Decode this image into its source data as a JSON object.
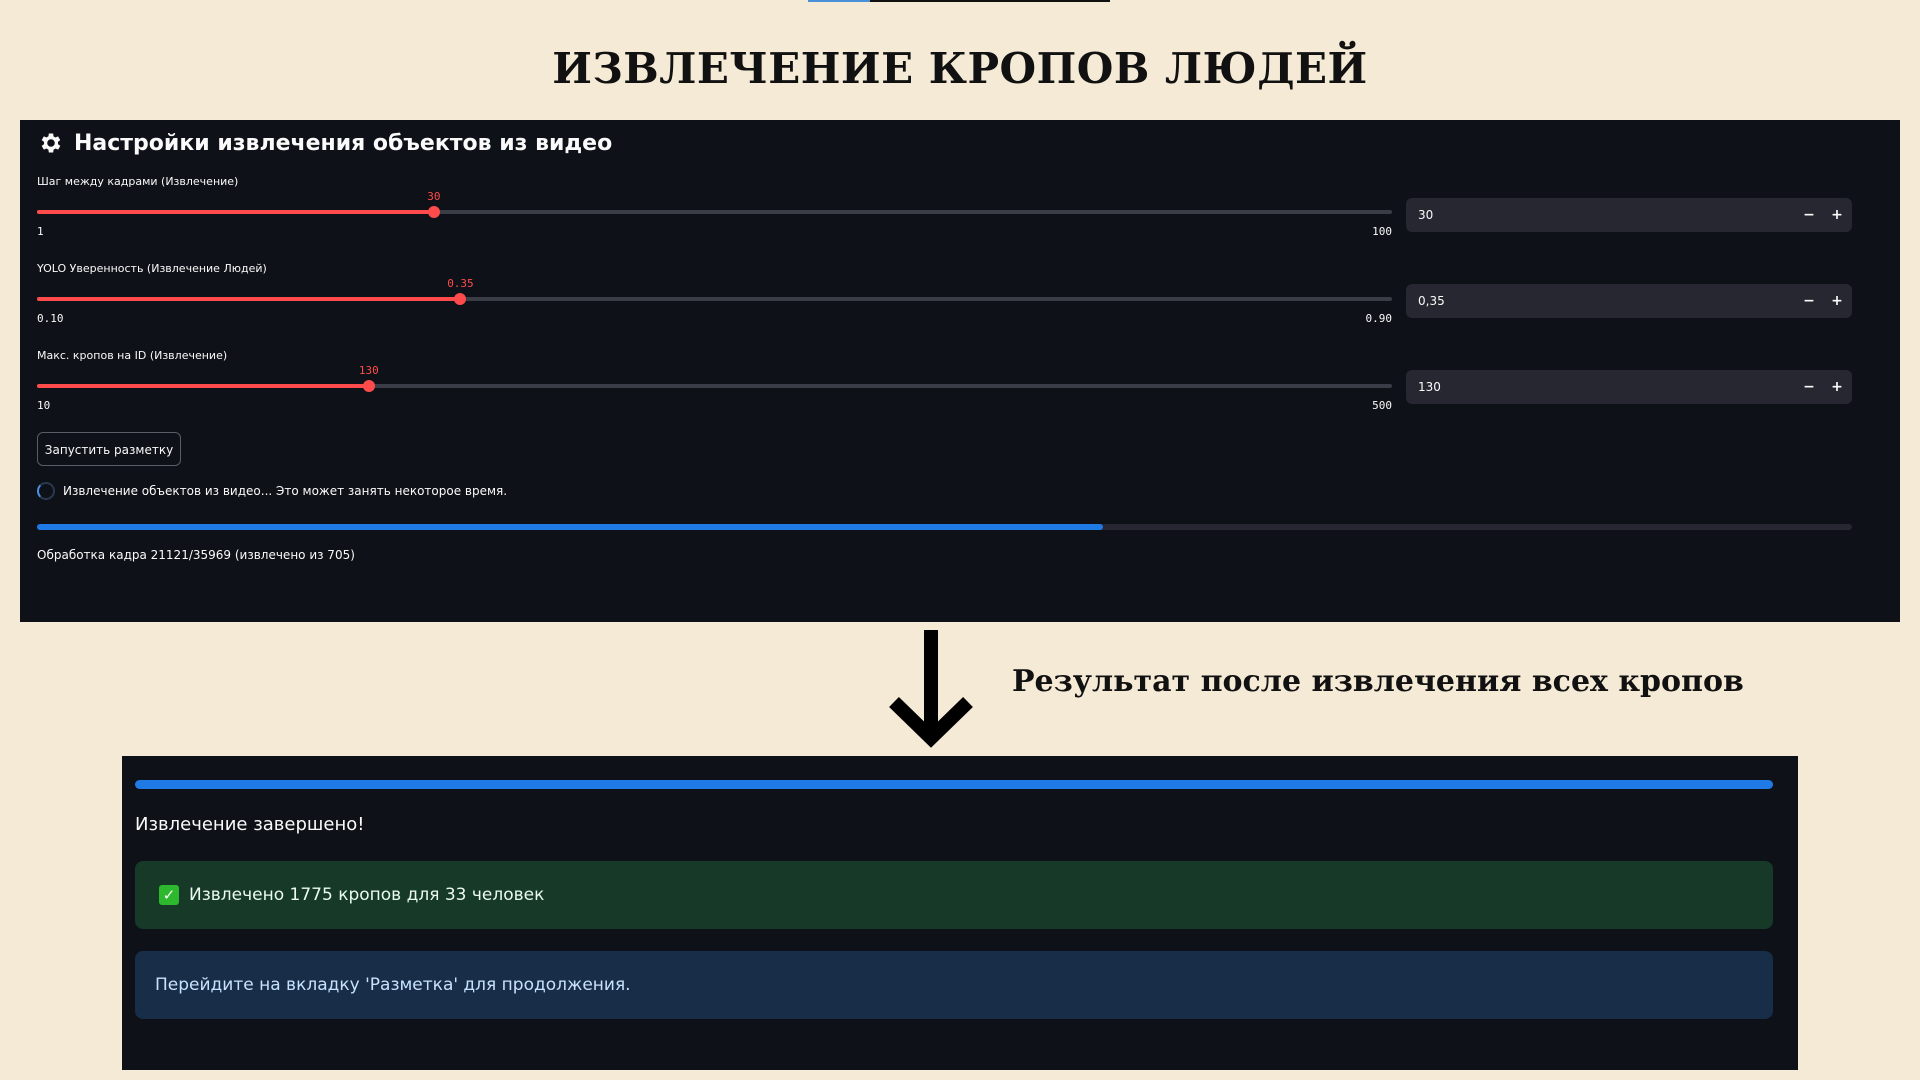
{
  "page": {
    "title": "ИЗВЛЕЧЕНИЕ КРОПОВ ЛЮДЕЙ",
    "result_caption": "Результат после извлечения всех кропов"
  },
  "settings": {
    "header": "Настройки извлечения объектов из видео",
    "header_icon": "gear-icon",
    "sliders": [
      {
        "label": "Шаг между кадрами (Извлечение)",
        "value": 30,
        "value_text": "30",
        "min": 1,
        "min_text": "1",
        "max": 100,
        "max_text": "100",
        "input_value": "30"
      },
      {
        "label": "YOLO Уверенность (Извлечение Людей)",
        "value": 0.35,
        "value_text": "0.35",
        "min": 0.1,
        "min_text": "0.10",
        "max": 0.9,
        "max_text": "0.90",
        "input_value": "0,35"
      },
      {
        "label": "Макс. кропов на ID (Извлечение)",
        "value": 130,
        "value_text": "130",
        "min": 10,
        "min_text": "10",
        "max": 500,
        "max_text": "500",
        "input_value": "130"
      }
    ],
    "stepper_minus": "−",
    "stepper_plus": "+",
    "run_button": "Запустить разметку",
    "spinner_text": "Извлечение объектов из видео... Это может занять некоторое время.",
    "progress": 0.5872,
    "progress_text": "Обработка кадра 21121/35969 (извлечено из 705)"
  },
  "result": {
    "progress": 1.0,
    "done_text": "Извлечение завершено!",
    "success_icon": "check-icon",
    "success_text": "Извлечено 1775 кропов для 33 человек",
    "info_text": "Перейдите на вкладку 'Разметка' для продолжения."
  },
  "colors": {
    "background": "#f5ead6",
    "panel": "#0e1117",
    "slider_accent": "#ff4b4b",
    "progress_blue": "#1f7ae5",
    "success_bg": "#173928",
    "info_bg": "#172d48"
  }
}
